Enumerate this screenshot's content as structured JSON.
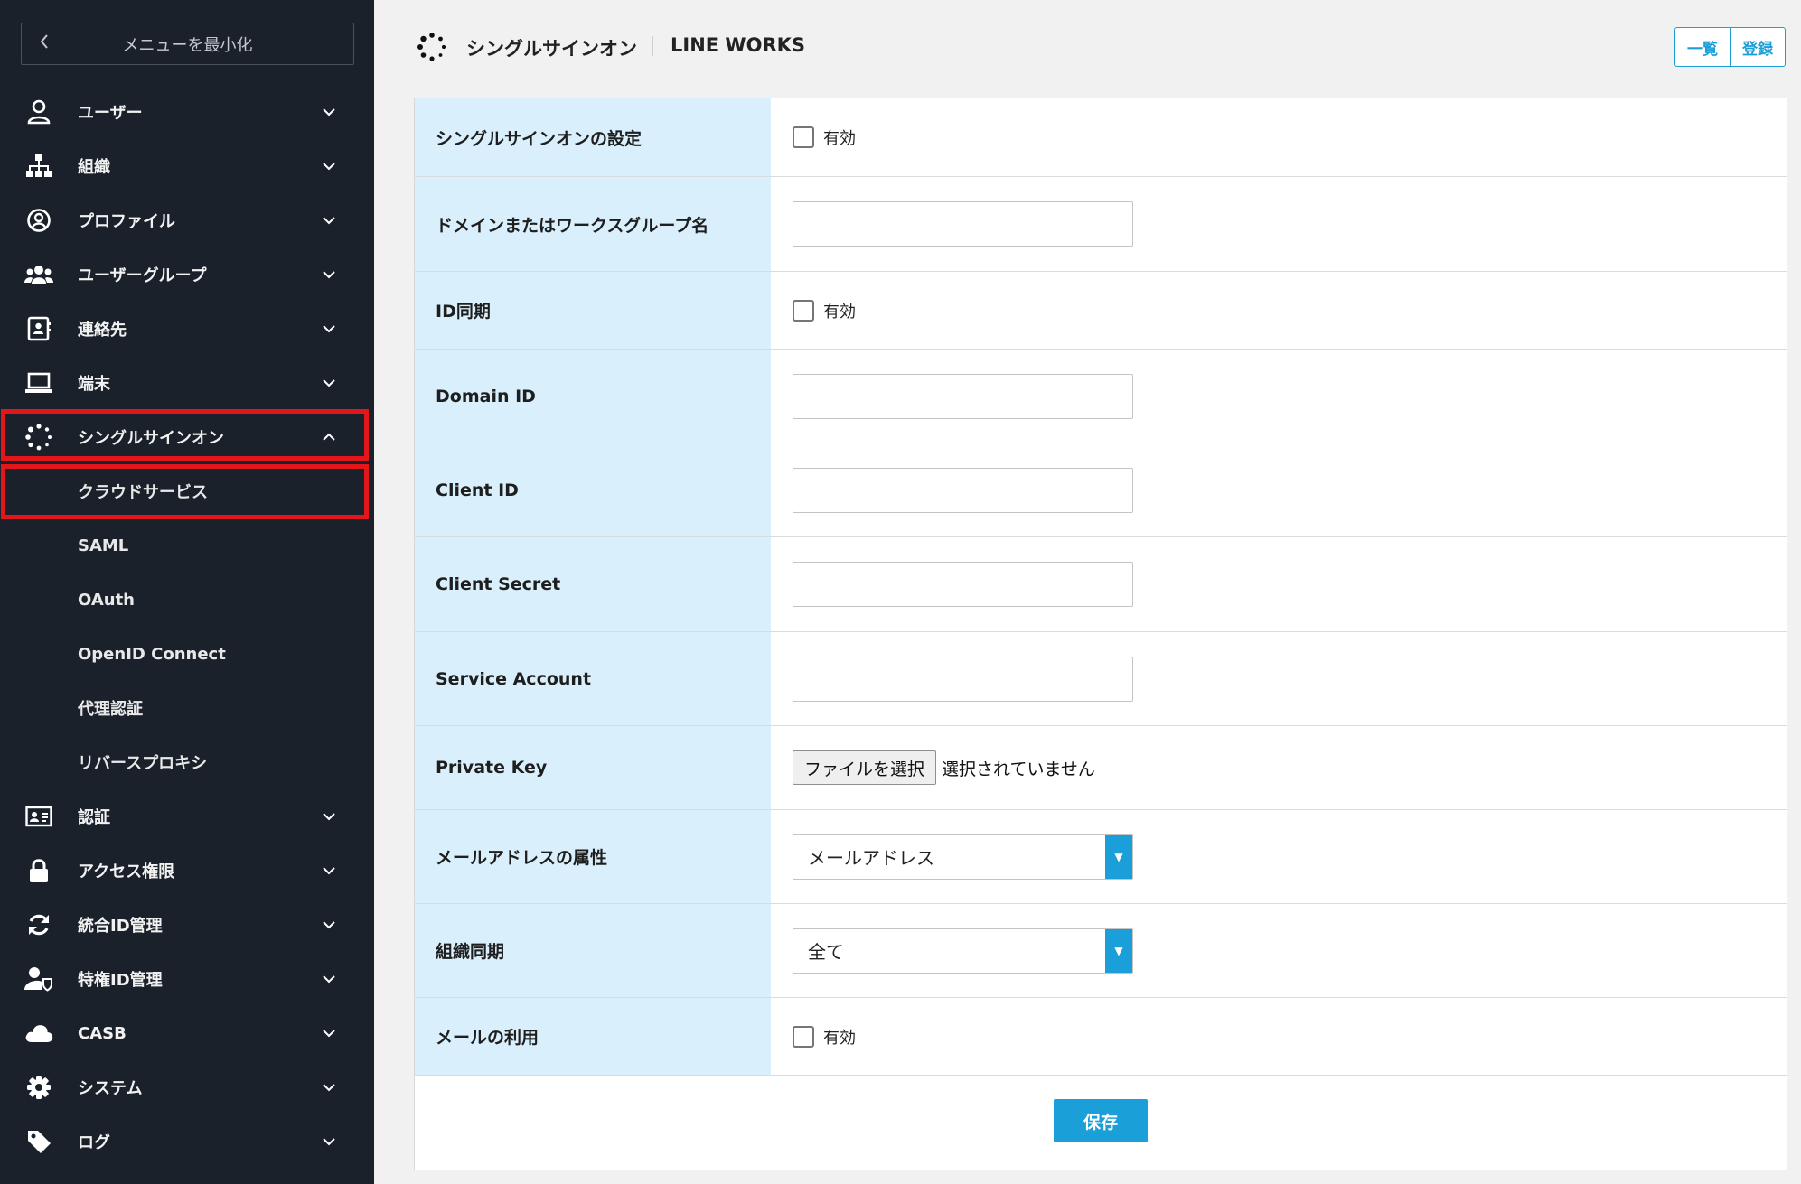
{
  "sidebar": {
    "collapse_label": "メニューを最小化",
    "items": [
      {
        "label": "ユーザー",
        "icon": "user-icon"
      },
      {
        "label": "組織",
        "icon": "org-chart-icon"
      },
      {
        "label": "プロファイル",
        "icon": "profile-icon"
      },
      {
        "label": "ユーザーグループ",
        "icon": "user-group-icon"
      },
      {
        "label": "連絡先",
        "icon": "contact-book-icon"
      },
      {
        "label": "端末",
        "icon": "laptop-icon"
      },
      {
        "label": "シングルサインオン",
        "icon": "sso-dots-icon",
        "expanded": true
      }
    ],
    "sub_items": [
      {
        "label": "クラウドサービス",
        "selected": true
      },
      {
        "label": "SAML"
      },
      {
        "label": "OAuth"
      },
      {
        "label": "OpenID Connect"
      },
      {
        "label": "代理認証"
      },
      {
        "label": "リバースプロキシ"
      }
    ],
    "items_after": [
      {
        "label": "認証",
        "icon": "id-card-icon"
      },
      {
        "label": "アクセス権限",
        "icon": "lock-icon"
      },
      {
        "label": "統合ID管理",
        "icon": "sync-icon"
      },
      {
        "label": "特権ID管理",
        "icon": "user-shield-icon"
      },
      {
        "label": "CASB",
        "icon": "cloud-icon"
      },
      {
        "label": "システム",
        "icon": "gear-icon"
      },
      {
        "label": "ログ",
        "icon": "tag-icon"
      }
    ],
    "highlight_color": "#e2161b"
  },
  "header": {
    "icon": "sso-dots-icon",
    "title": "シングルサインオン",
    "subtitle": "LINE WORKS",
    "buttons": [
      "一覧",
      "登録"
    ]
  },
  "form": {
    "rows": [
      {
        "label": "シングルサインオンの設定",
        "type": "checkbox",
        "option": "有効",
        "checked": false
      },
      {
        "label": "ドメインまたはワークスグループ名",
        "type": "text",
        "value": ""
      },
      {
        "label": "ID同期",
        "type": "checkbox",
        "option": "有効",
        "checked": false
      },
      {
        "label": "Domain ID",
        "type": "text",
        "value": ""
      },
      {
        "label": "Client ID",
        "type": "text",
        "value": ""
      },
      {
        "label": "Client Secret",
        "type": "text",
        "value": ""
      },
      {
        "label": "Service Account",
        "type": "text",
        "value": ""
      },
      {
        "label": "Private Key",
        "type": "file",
        "button": "ファイルを選択",
        "status": "選択されていません"
      },
      {
        "label": "メールアドレスの属性",
        "type": "select",
        "value": "メールアドレス"
      },
      {
        "label": "組織同期",
        "type": "select",
        "value": "全て"
      },
      {
        "label": "メールの利用",
        "type": "checkbox",
        "option": "有効",
        "checked": false
      }
    ],
    "save_label": "保存"
  },
  "colors": {
    "sidebar_bg": "#1a212b",
    "accent": "#1a9fd8",
    "label_bg": "#d9f0fc"
  }
}
